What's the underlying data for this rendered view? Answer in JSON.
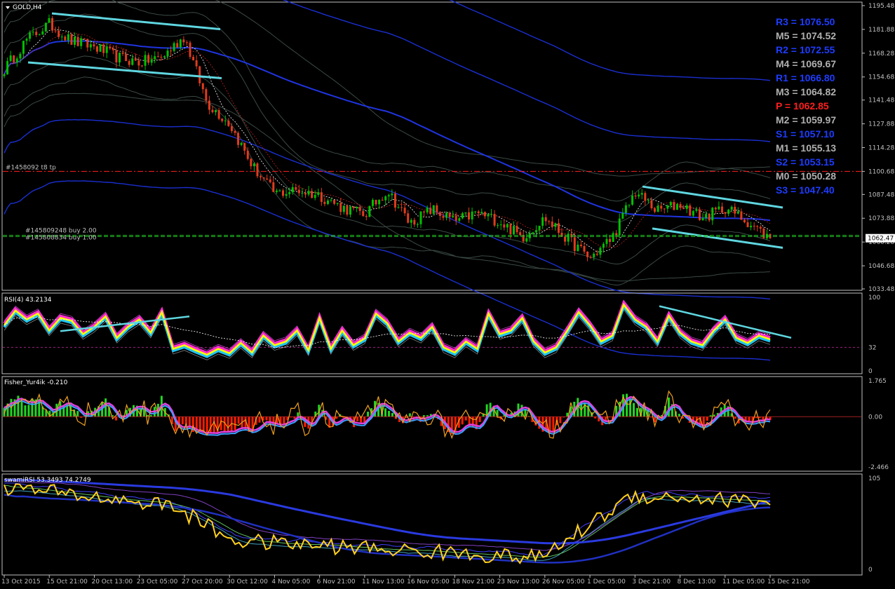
{
  "window": {
    "symbol_title": "GOLD,H4"
  },
  "colors": {
    "background": "#000000",
    "frame": "#c0c0c0",
    "bull": "#00c000",
    "bear": "#e03c1e",
    "cyan_trend": "#5fd6e0",
    "blue_band": "#1a2fd0",
    "gray_band": "#3a4a44",
    "pivot_blue": "#1e3cff",
    "pivot_gray": "#b0b0b0",
    "pivot_red": "#ff1e1e",
    "rsi_yellow": "#ffff00",
    "rsi_magenta": "#ff2bd0",
    "rsi_cyan": "#22c4f0",
    "hist_green": "#22d622",
    "hist_red": "#ff1e00",
    "fisher_orange": "#f0a020",
    "fisher_blue": "#3aa0ff"
  },
  "pivots": [
    {
      "label": "R3 = 1076.50",
      "level": 1076.5,
      "kind": "blue"
    },
    {
      "label": "M5 = 1074.52",
      "level": 1074.52,
      "kind": "gray"
    },
    {
      "label": "R2 = 1072.55",
      "level": 1072.55,
      "kind": "blue"
    },
    {
      "label": "M4 = 1069.67",
      "level": 1069.67,
      "kind": "gray"
    },
    {
      "label": "R1 = 1066.80",
      "level": 1066.8,
      "kind": "blue"
    },
    {
      "label": "M3 = 1064.82",
      "level": 1064.82,
      "kind": "gray"
    },
    {
      "label": "P   = 1062.85",
      "level": 1062.85,
      "kind": "red"
    },
    {
      "label": "M2 = 1059.97",
      "level": 1059.97,
      "kind": "gray"
    },
    {
      "label": "S1 = 1057.10",
      "level": 1057.1,
      "kind": "blue"
    },
    {
      "label": "M1 = 1055.13",
      "level": 1055.13,
      "kind": "gray"
    },
    {
      "label": "S2 = 1053.15",
      "level": 1053.15,
      "kind": "blue"
    },
    {
      "label": "M0 = 1050.28",
      "level": 1050.28,
      "kind": "gray"
    },
    {
      "label": "S3 = 1047.40",
      "level": 1047.4,
      "kind": "blue"
    }
  ],
  "order_labels": {
    "tp_line": "#1458092 t8 tp",
    "buy1": "#145809248 buy 2.00",
    "buy2": "#145808834 buy 1.00"
  },
  "chart_data": [
    {
      "type": "candlestick",
      "title": "GOLD,H4",
      "ylim": [
        1033.48,
        1195.48
      ],
      "price_ticks": [
        "1195.48",
        "1181.88",
        "1168.28",
        "1154.68",
        "1141.48",
        "1127.88",
        "1114.28",
        "1100.68",
        "1087.48",
        "1073.88",
        "1060.28",
        "1046.68",
        "1033.48"
      ],
      "current_price": "1062.47",
      "current_price_value": 1062.47,
      "x": [
        "13 Oct 2015",
        "15 Oct 21:00",
        "20 Oct 13:00",
        "23 Oct 05:00",
        "27 Oct 20:00",
        "30 Oct 12:00",
        "4 Nov 05:00",
        "6 Nov 21:00",
        "11 Nov 13:00",
        "16 Nov 05:00",
        "18 Nov 21:00",
        "23 Nov 13:00",
        "26 Nov 05:00",
        "1 Dec 05:00",
        "3 Dec 21:00",
        "8 Dec 13:00",
        "11 Dec 05:00",
        "15 Dec 21:00"
      ],
      "close_path": [
        [
          0,
          1159
        ],
        [
          2,
          1176
        ],
        [
          4,
          1185
        ],
        [
          6,
          1175
        ],
        [
          8,
          1172
        ],
        [
          10,
          1166
        ],
        [
          12,
          1163
        ],
        [
          14,
          1166
        ],
        [
          16,
          1178
        ],
        [
          18,
          1140
        ],
        [
          20,
          1128
        ],
        [
          22,
          1104
        ],
        [
          24,
          1088
        ],
        [
          26,
          1090
        ],
        [
          28,
          1087
        ],
        [
          30,
          1080
        ],
        [
          32,
          1076
        ],
        [
          34,
          1090
        ],
        [
          36,
          1071
        ],
        [
          38,
          1079
        ],
        [
          40,
          1072
        ],
        [
          42,
          1077
        ],
        [
          44,
          1072
        ],
        [
          46,
          1063
        ],
        [
          48,
          1074
        ],
        [
          50,
          1062
        ],
        [
          52,
          1051
        ],
        [
          54,
          1063
        ],
        [
          56,
          1089
        ],
        [
          58,
          1078
        ],
        [
          60,
          1082
        ],
        [
          62,
          1074
        ],
        [
          64,
          1080
        ],
        [
          66,
          1072
        ],
        [
          68,
          1062
        ]
      ],
      "order_levels": [
        1100.68,
        1064.1,
        1063.4
      ]
    },
    {
      "type": "line",
      "title": "RSI(4) 43.2134",
      "ylim": [
        0,
        100
      ],
      "ticks": [
        "100",
        "32",
        "0"
      ],
      "series": [
        {
          "name": "RSI(4)",
          "values": [
            62,
            82,
            70,
            78,
            55,
            72,
            68,
            50,
            60,
            74,
            45,
            60,
            70,
            52,
            80,
            30,
            35,
            28,
            22,
            30,
            24,
            38,
            25,
            48,
            35,
            40,
            55,
            28,
            72,
            30,
            55,
            35,
            44,
            78,
            65,
            40,
            52,
            45,
            60,
            32,
            25,
            40,
            30,
            78,
            50,
            55,
            72,
            40,
            25,
            32,
            55,
            80,
            62,
            40,
            48,
            90,
            70,
            60,
            40,
            75,
            52,
            40,
            35,
            55,
            70,
            45,
            38,
            48,
            43
          ]
        }
      ]
    },
    {
      "type": "bar",
      "title": "Fisher_Yur4ik -0.210",
      "ylim": [
        -2.466,
        1.765
      ],
      "ticks": [
        "1.765",
        "0.00",
        "-2.466"
      ]
    },
    {
      "type": "line",
      "title": "swamiRSI 53.3493 74.2749",
      "ylim": [
        0,
        105
      ],
      "ticks": [
        "105",
        "0"
      ]
    }
  ]
}
